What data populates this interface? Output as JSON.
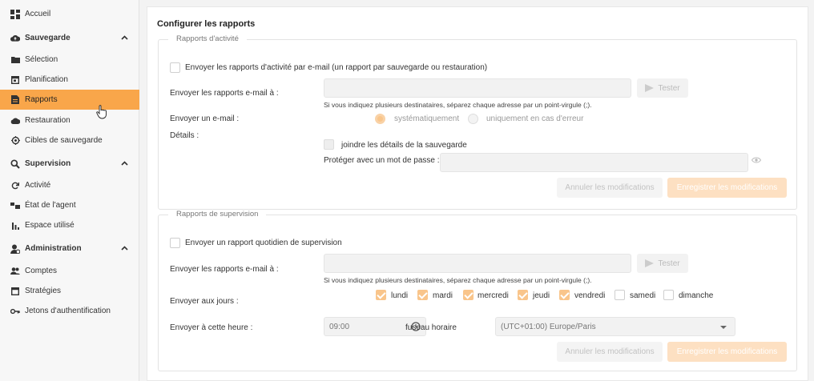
{
  "sidebar": {
    "home": "Accueil",
    "backup": {
      "label": "Sauvegarde",
      "items": [
        "Sélection",
        "Planification",
        "Rapports",
        "Restauration",
        "Cibles de sauvegarde"
      ]
    },
    "supervision": {
      "label": "Supervision",
      "items": [
        "Activité",
        "État de l'agent",
        "Espace utilisé"
      ]
    },
    "admin": {
      "label": "Administration",
      "items": [
        "Comptes",
        "Stratégies",
        "Jetons d'authentification"
      ]
    },
    "active_item": "Rapports"
  },
  "main": {
    "title": "Configurer les rapports",
    "activity": {
      "legend": "Rapports d'activité",
      "enable_label": "Envoyer les rapports d'activité par e-mail (un rapport par sauvegarde ou restauration)",
      "email_label": "Envoyer les rapports e-mail à :",
      "email_value": "",
      "test_label": "Tester",
      "help": "Si vous indiquez plusieurs destinataires, séparez chaque adresse par un point-virgule (;).",
      "send_label": "Envoyer un e-mail :",
      "option_always": "systématiquement",
      "option_error": "uniquement en cas d'erreur",
      "details_label": "Détails :",
      "attach_label": "joindre les détails de la sauvegarde",
      "password_label": "Protéger avec un mot de passe :",
      "password_value": "",
      "cancel_label": "Annuler les modifications",
      "save_label": "Enregistrer les modifications"
    },
    "supervision": {
      "legend": "Rapports de supervision",
      "enable_label": "Envoyer un rapport quotidien de supervision",
      "email_label": "Envoyer les rapports e-mail à :",
      "email_value": "",
      "test_label": "Tester",
      "help": "Si vous indiquez plusieurs destinataires, séparez chaque adresse par un point-virgule (;).",
      "days_label": "Envoyer aux jours :",
      "days": [
        {
          "label": "lundi",
          "checked": true
        },
        {
          "label": "mardi",
          "checked": true
        },
        {
          "label": "mercredi",
          "checked": true
        },
        {
          "label": "jeudi",
          "checked": true
        },
        {
          "label": "vendredi",
          "checked": true
        },
        {
          "label": "samedi",
          "checked": false
        },
        {
          "label": "dimanche",
          "checked": false
        }
      ],
      "time_label": "Envoyer à cette heure :",
      "time_value": "09:00",
      "tz_label": "fuseau horaire",
      "tz_value": "(UTC+01:00) Europe/Paris",
      "cancel_label": "Annuler les modifications",
      "save_label": "Enregistrer les modifications"
    }
  },
  "colors": {
    "accent": "#f9a64a",
    "accent_light": "#fde0c2",
    "check_on": "#f9c58b"
  }
}
